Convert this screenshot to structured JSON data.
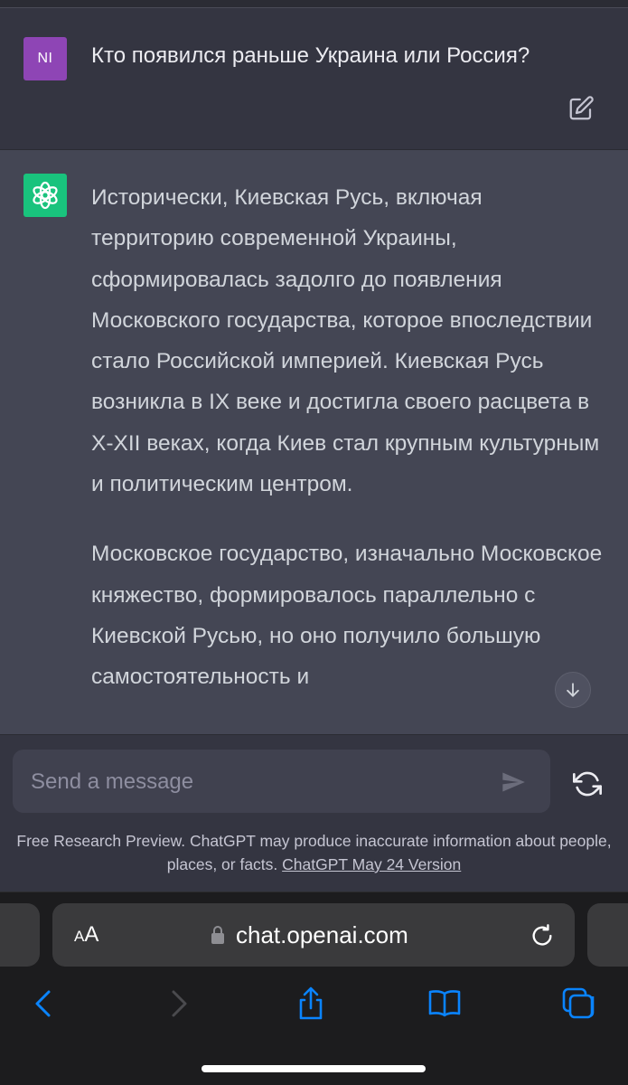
{
  "user_message": {
    "avatar_initials": "NI",
    "text": "Кто появился раньше Украина или Россия?"
  },
  "assistant_message": {
    "paragraphs": [
      "Исторически, Киевская Русь, включая территорию современной Украины, сформировалась задолго до появления Московского государства, которое впоследствии стало Российской империей. Киевская Русь возникла в IX веке и достигла своего расцвета в X-XII веках, когда Киев стал крупным культурным и политическим центром.",
      "Московское государство, изначально Московское княжество, формировалось параллельно с Киевской Русью, но оно получило большую самостоятельность и"
    ]
  },
  "composer": {
    "placeholder": "Send a message"
  },
  "disclaimer": {
    "text": "Free Research Preview. ChatGPT may produce inaccurate information about people, places, or facts. ",
    "link": "ChatGPT May 24 Version"
  },
  "browser": {
    "aa_small": "A",
    "aa_large": "A",
    "url": "chat.openai.com"
  },
  "colors": {
    "user_avatar": "#8e45b5",
    "bot_avatar": "#19c37d",
    "ios_blue": "#0a84ff"
  },
  "icons": {
    "edit": "edit-icon",
    "openai_logo": "openai-logo-icon",
    "scroll_down": "arrow-down-icon",
    "send": "send-icon",
    "regenerate": "regenerate-icon",
    "lock": "lock-icon",
    "reload": "reload-icon",
    "back": "chevron-left-icon",
    "forward": "chevron-right-icon",
    "share": "share-icon",
    "bookmarks": "book-icon",
    "tabs": "tabs-icon"
  }
}
